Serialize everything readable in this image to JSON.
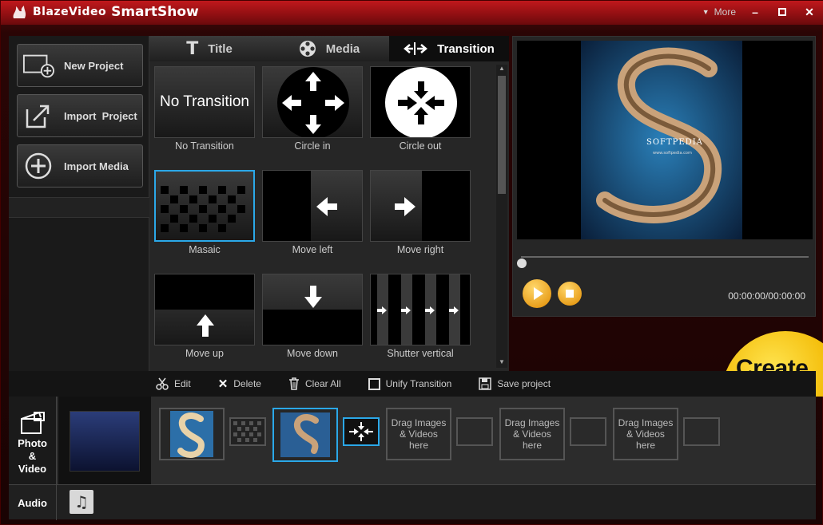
{
  "app": {
    "brand": "BlazeVideo",
    "product": "SmartShow",
    "more_label": "More"
  },
  "left_buttons": [
    {
      "label": "New Project"
    },
    {
      "label": "Import  Project"
    },
    {
      "label": "Import Media"
    }
  ],
  "tabs": [
    {
      "label": "Title",
      "icon": "title-icon"
    },
    {
      "label": "Media",
      "icon": "film-reel-icon"
    },
    {
      "label": "Transition",
      "icon": "transition-icon"
    }
  ],
  "transitions": [
    {
      "label": "No Transition",
      "thumb_text": "No Transition"
    },
    {
      "label": "Circle in"
    },
    {
      "label": "Circle out"
    },
    {
      "label": "Masaic"
    },
    {
      "label": "Move left"
    },
    {
      "label": "Move right"
    },
    {
      "label": "Move up"
    },
    {
      "label": "Move down"
    },
    {
      "label": "Shutter vertical"
    }
  ],
  "preview": {
    "time": "00:00:00/00:00:00",
    "watermark": "SOFTPEDIA",
    "watermark_small": "www.softpedia.com"
  },
  "create_label": "Create",
  "toolbar": {
    "edit": "Edit",
    "delete": "Delete",
    "clear_all": "Clear All",
    "unify": "Unify Transition",
    "save": "Save project"
  },
  "timeline": {
    "photo_video_label": [
      "Photo",
      "&",
      "Video"
    ],
    "audio_label": "Audio",
    "drag_text": [
      "Drag Images",
      "& Videos",
      "here"
    ]
  }
}
